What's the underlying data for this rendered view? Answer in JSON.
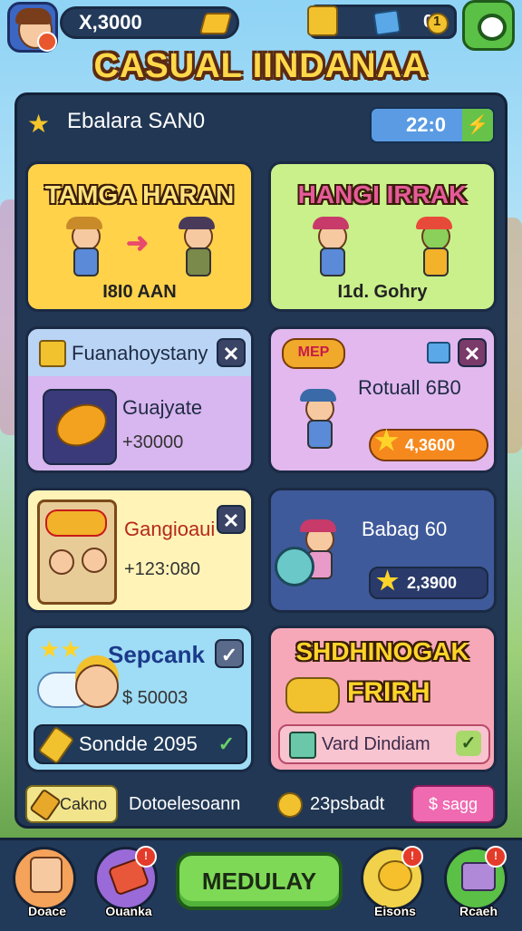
{
  "top": {
    "coins": "X,3000",
    "resource_value": "0",
    "resource_value_2": "1"
  },
  "title": "CASUAL IINDANAA",
  "header": {
    "title": "Ebalara SAN0",
    "timer": "22:0",
    "go_icon": "⚡"
  },
  "cards": {
    "c1": {
      "title": "TAMGA HARAN",
      "sub": "I8I0 AAN",
      "color": "#ffd24a"
    },
    "c2": {
      "title": "HANGI IRRAK",
      "sub": "I1d. Gohry",
      "color": "#c9f08a"
    },
    "c3": {
      "heading": "Fuanahoystany",
      "item": "Guajyate",
      "price": "+30000"
    },
    "c4": {
      "tag": "MEP",
      "item": "Rotuall 6B0",
      "price": "4,3600"
    },
    "c5": {
      "item": "Gangioaui",
      "price": "+123:080"
    },
    "c6": {
      "item": "Babag 60",
      "price": "2,3900"
    },
    "c7": {
      "heading": "Sepcank",
      "price": "$ 50003",
      "button": "Sondde 2095"
    },
    "c8": {
      "title1": "SHDHINOGAK",
      "title2": "FRIRH",
      "button": "Vard Dindiam"
    }
  },
  "bottom_row": {
    "left_btn": "Cakno",
    "middle": "Dotoelesoann",
    "coin_text": "23psbadt",
    "right_btn": "$ sagg"
  },
  "nav": {
    "n1": "Doace",
    "n2": "Ouanka",
    "play": "MEDULAY",
    "n4": "Eisons",
    "n5": "Rcaeh",
    "badge": "!"
  }
}
